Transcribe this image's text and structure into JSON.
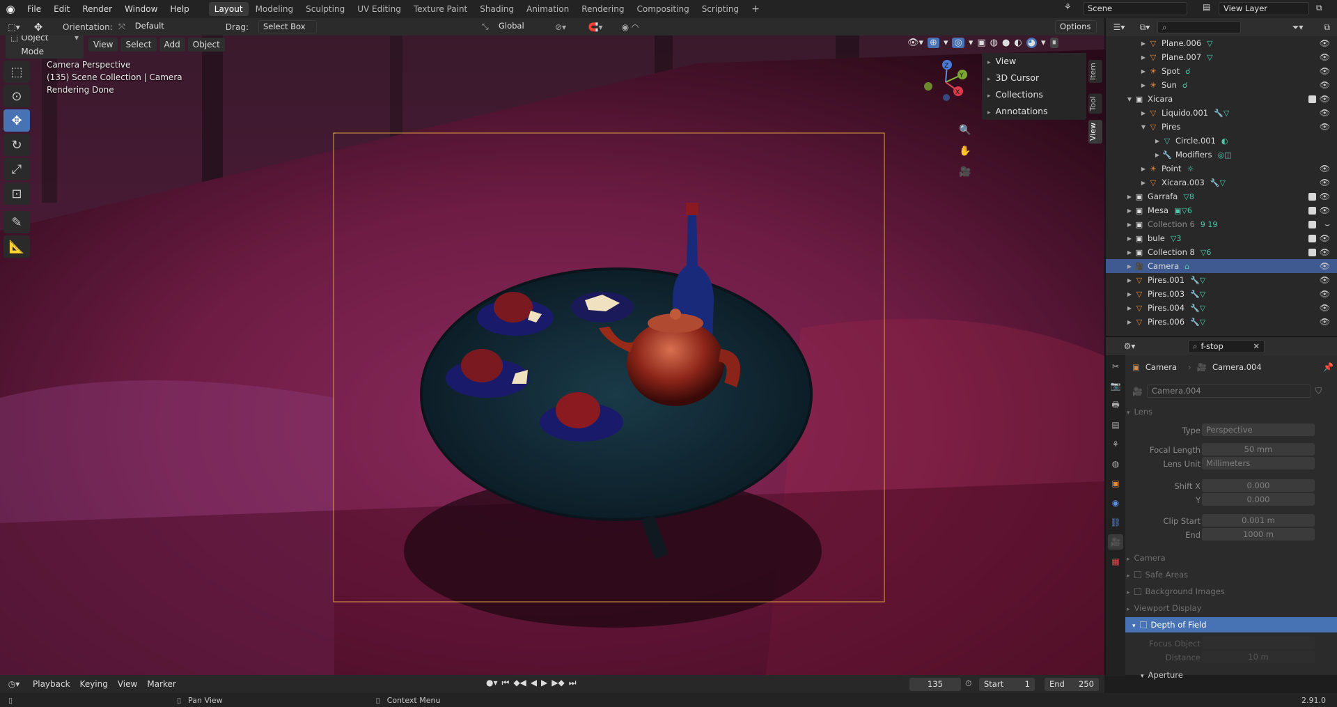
{
  "menu": {
    "file": "File",
    "edit": "Edit",
    "render": "Render",
    "window": "Window",
    "help": "Help"
  },
  "workspaces": [
    "Layout",
    "Modeling",
    "Sculpting",
    "UV Editing",
    "Texture Paint",
    "Shading",
    "Animation",
    "Rendering",
    "Compositing",
    "Scripting"
  ],
  "scene": {
    "name": "Scene",
    "view_layer": "View Layer"
  },
  "header": {
    "orientation_label": "Orientation:",
    "orientation_value": "Default",
    "drag_label": "Drag:",
    "drag_value": "Select Box",
    "transform_orientation": "Global",
    "options": "Options"
  },
  "viewport_header": {
    "mode": "Object Mode",
    "view": "View",
    "select": "Select",
    "add": "Add",
    "object": "Object"
  },
  "viewport_overlay": {
    "line1": "Camera Perspective",
    "line2": "(135) Scene Collection | Camera",
    "line3": "Rendering Done"
  },
  "n_panel": {
    "items": [
      "View",
      "3D Cursor",
      "Collections",
      "Annotations"
    ],
    "tabs": [
      "Item",
      "Tool",
      "View"
    ]
  },
  "gizmo": {
    "z": "Z",
    "y": "Y",
    "x": "X"
  },
  "outliner": {
    "search_placeholder": "",
    "rows": [
      {
        "indent": 1,
        "label": "Plane.006",
        "icon": "mesh-icon",
        "extra": "▽",
        "vis": "👁"
      },
      {
        "indent": 1,
        "label": "Plane.007",
        "icon": "mesh-icon",
        "extra": "▽",
        "vis": "👁"
      },
      {
        "indent": 1,
        "label": "Spot",
        "icon": "light-icon",
        "extra": "☌",
        "vis": "👁"
      },
      {
        "indent": 1,
        "label": "Sun",
        "icon": "light-icon",
        "extra": "☌",
        "vis": "👁"
      },
      {
        "indent": 0,
        "label": "Xicara",
        "icon": "collection-icon",
        "extra": "",
        "vis": "👁",
        "chk": true,
        "open": true
      },
      {
        "indent": 1,
        "label": "Liquido.001",
        "icon": "mesh-icon",
        "extra": "🔧▽",
        "vis": "👁"
      },
      {
        "indent": 1,
        "label": "Pires",
        "icon": "mesh-icon",
        "extra": "",
        "vis": "👁",
        "open": true
      },
      {
        "indent": 2,
        "label": "Circle.001",
        "icon": "mesh-data-icon",
        "extra": "◐",
        "vis": ""
      },
      {
        "indent": 2,
        "label": "Modifiers",
        "icon": "wrench-icon",
        "extra": "◎◫",
        "vis": ""
      },
      {
        "indent": 1,
        "label": "Point",
        "icon": "light-icon",
        "extra": "☼",
        "vis": "👁"
      },
      {
        "indent": 1,
        "label": "Xicara.003",
        "icon": "mesh-icon",
        "extra": "🔧▽",
        "vis": "👁"
      },
      {
        "indent": 0,
        "label": "Garrafa",
        "icon": "collection-icon",
        "extra": "▽8",
        "vis": "👁",
        "chk": true
      },
      {
        "indent": 0,
        "label": "Mesa",
        "icon": "collection-icon",
        "extra": "▣▽6",
        "vis": "👁",
        "chk": true
      },
      {
        "indent": 0,
        "label": "Collection 6",
        "icon": "collection-icon",
        "extra": "9 19",
        "vis": "⌣",
        "chk": true,
        "dim": true
      },
      {
        "indent": 0,
        "label": "bule",
        "icon": "collection-icon",
        "extra": "▽3",
        "vis": "👁",
        "chk": true
      },
      {
        "indent": 0,
        "label": "Collection 8",
        "icon": "collection-icon",
        "extra": "▽6",
        "vis": "👁",
        "chk": true
      },
      {
        "indent": 0,
        "label": "Camera",
        "icon": "camera-icon",
        "extra": "⌂",
        "vis": "👁",
        "sel": true
      },
      {
        "indent": 0,
        "label": "Pires.001",
        "icon": "mesh-icon",
        "extra": "🔧▽",
        "vis": "👁"
      },
      {
        "indent": 0,
        "label": "Pires.003",
        "icon": "mesh-icon",
        "extra": "🔧▽",
        "vis": "👁"
      },
      {
        "indent": 0,
        "label": "Pires.004",
        "icon": "mesh-icon",
        "extra": "🔧▽",
        "vis": "👁"
      },
      {
        "indent": 0,
        "label": "Pires.006",
        "icon": "mesh-icon",
        "extra": "🔧▽",
        "vis": "👁"
      }
    ]
  },
  "properties": {
    "search_value": "f-stop",
    "breadcrumb": {
      "object": "Camera",
      "data": "Camera.004"
    },
    "datablock": "Camera.004",
    "lens_section": "Lens",
    "type_label": "Type",
    "type_value": "Perspective",
    "focal_label": "Focal Length",
    "focal_value": "50 mm",
    "lens_unit_label": "Lens Unit",
    "lens_unit_value": "Millimeters",
    "shiftx_label": "Shift X",
    "shiftx_value": "0.000",
    "shifty_label": "Y",
    "shifty_value": "0.000",
    "clip_start_label": "Clip Start",
    "clip_start_value": "0.001 m",
    "clip_end_label": "End",
    "clip_end_value": "1000 m",
    "sections": [
      "Camera",
      "Safe Areas",
      "Background Images",
      "Viewport Display"
    ],
    "dof": "Depth of Field",
    "focus_object_label": "Focus Object",
    "distance_label": "Distance",
    "distance_value": "10 m",
    "aperture": "Aperture"
  },
  "timeline": {
    "playback": "Playback",
    "keying": "Keying",
    "view": "View",
    "marker": "Marker",
    "current_frame": "135",
    "start_label": "Start",
    "start": "1",
    "end_label": "End",
    "end": "250"
  },
  "status": {
    "pan": "Pan View",
    "context": "Context Menu",
    "version": "2.91.0"
  },
  "colors": {
    "accent": "#4772b3",
    "selected_row": "#3e5a91",
    "camera_frame": "#e0a040"
  }
}
